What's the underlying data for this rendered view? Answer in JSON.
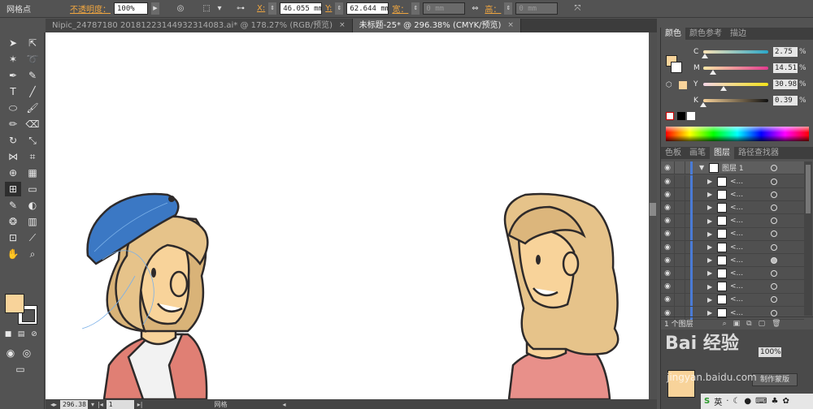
{
  "control_bar": {
    "tool_name": "网格点",
    "opacity_label": "不透明度：",
    "opacity_value": "100%",
    "x_label": "X:",
    "x_value": "46.055 mm",
    "y_label": "Y:",
    "y_value": "62.644 mm",
    "width_label": "宽：",
    "width_value": "0 mm",
    "height_label": "高：",
    "height_value": "0 mm"
  },
  "tabs": [
    {
      "label": "Nipic_24787180 20181223144932314083.ai* @ 178.27% (RGB/预览)",
      "close": "×"
    },
    {
      "label": "未标题-25* @ 296.38% (CMYK/预览)",
      "close": "×"
    }
  ],
  "status_bar": {
    "zoom": "296.38",
    "page": "1",
    "tool": "网格"
  },
  "color_panel": {
    "tabs": [
      "颜色",
      "颜色参考",
      "描边"
    ],
    "fill_color": "#f8d39a",
    "channels": [
      {
        "label": "C",
        "value": "2.75",
        "level": 0.0275,
        "gradient": "linear-gradient(to right,#fbe3b5,#2aa7c9)"
      },
      {
        "label": "M",
        "value": "14.51",
        "level": 0.1451,
        "gradient": "linear-gradient(to right,#f8e8a6,#e23a8e)"
      },
      {
        "label": "Y",
        "value": "30.98",
        "level": 0.3098,
        "gradient": "linear-gradient(to right,#f4d6e6,#f3e21a)"
      },
      {
        "label": "K",
        "value": "0.39",
        "level": 0.0039,
        "gradient": "linear-gradient(to right,#f8d39a,#111111)"
      }
    ],
    "percent": "%"
  },
  "layers_panel": {
    "tabs": [
      "色板",
      "画笔",
      "图层",
      "路径查找器"
    ],
    "layer_name": "图层 1",
    "sublayer_label": "<...",
    "sublayers": 11,
    "count_label": "1 个图层"
  },
  "watermark": {
    "text": "Bai 经验",
    "url": "jingyan.baidu.com",
    "button_label": "制作蒙版"
  },
  "taskbar": {
    "ime_label": "英"
  }
}
